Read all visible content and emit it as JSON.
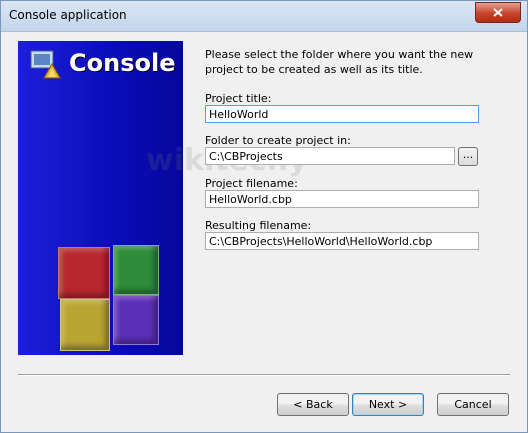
{
  "window": {
    "title": "Console application",
    "close_icon": "close-icon"
  },
  "banner": {
    "title": "Console",
    "icon": "console-app-icon",
    "cube_colors": [
      "#b8262e",
      "#2e8b3a",
      "#b9a531",
      "#5b2fb8"
    ],
    "background": "#0a0cb8"
  },
  "form": {
    "intro": "Please select the folder where you want the new project to be created as well as its title.",
    "project_title_label": "Project title:",
    "project_title_value": "HelloWorld",
    "folder_label": "Folder to create project in:",
    "folder_value": "C:\\CBProjects",
    "browse_label": "...",
    "filename_label": "Project filename:",
    "filename_value": "HelloWorld.cbp",
    "resulting_label": "Resulting filename:",
    "resulting_value": "C:\\CBProjects\\HelloWorld\\HelloWorld.cbp"
  },
  "watermark": "wikitechy",
  "buttons": {
    "back": "< Back",
    "next": "Next >",
    "cancel": "Cancel"
  }
}
